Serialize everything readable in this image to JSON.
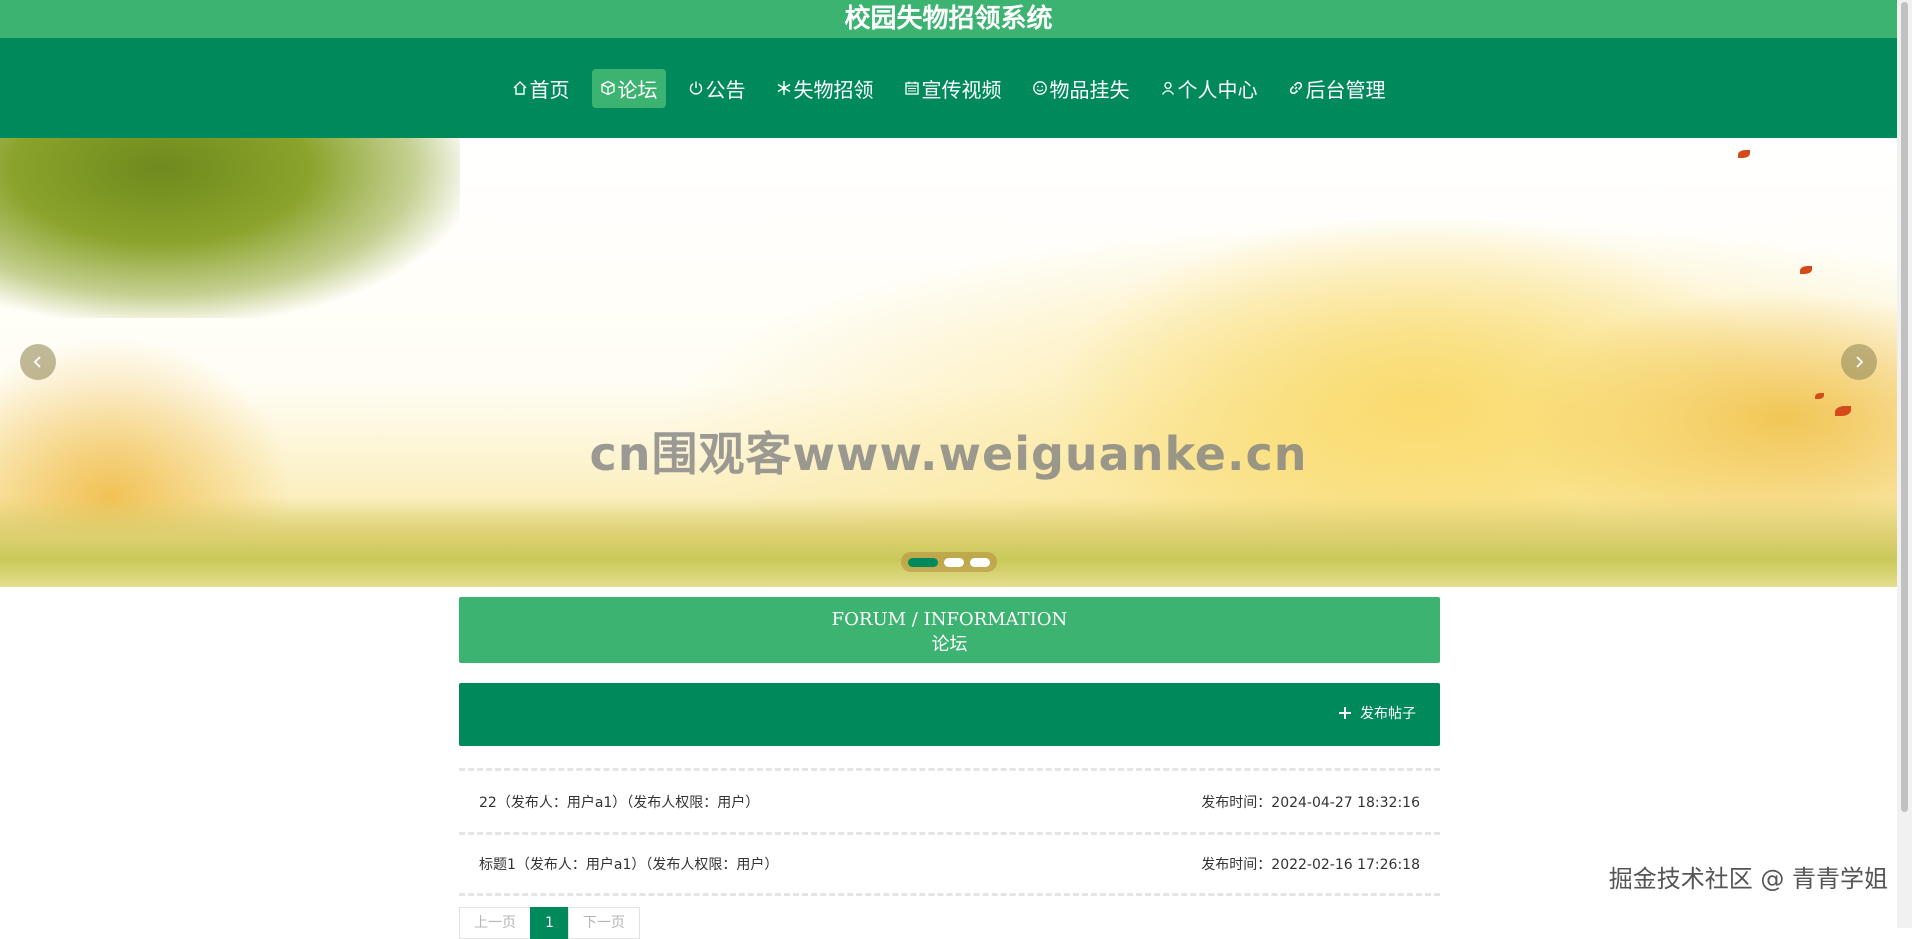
{
  "site": {
    "title": "校园失物招领系统"
  },
  "nav": [
    {
      "label": "首页",
      "icon": "home-icon"
    },
    {
      "label": "论坛",
      "icon": "box-icon",
      "active": true
    },
    {
      "label": "公告",
      "icon": "power-icon"
    },
    {
      "label": "失物招领",
      "icon": "snowflake-icon"
    },
    {
      "label": "宣传视频",
      "icon": "calendar-icon"
    },
    {
      "label": "物品挂失",
      "icon": "smile-icon"
    },
    {
      "label": "个人中心",
      "icon": "user-icon"
    },
    {
      "label": "后台管理",
      "icon": "link-icon"
    }
  ],
  "banner": {
    "watermark": "cn围观客www.weiguanke.cn",
    "slide_count": 3,
    "active_slide": 1
  },
  "section": {
    "title_en": "FORUM / INFORMATION",
    "title_cn": "论坛"
  },
  "toolbar": {
    "post_label": "发布帖子"
  },
  "posts": [
    {
      "title": "22（发布人：用户a1）（发布人权限：用户）",
      "time": "发布时间：2024-04-27 18:32:16"
    },
    {
      "title": "标题1（发布人：用户a1）（发布人权限：用户）",
      "time": "发布时间：2022-02-16 17:26:18"
    }
  ],
  "pagination": {
    "prev": "上一页",
    "current": "1",
    "next": "下一页"
  },
  "overlay": {
    "corner_watermark": "掘金技术社区 @ 青青学姐"
  },
  "colors": {
    "primary": "#008a5c",
    "accent": "#3db372"
  }
}
